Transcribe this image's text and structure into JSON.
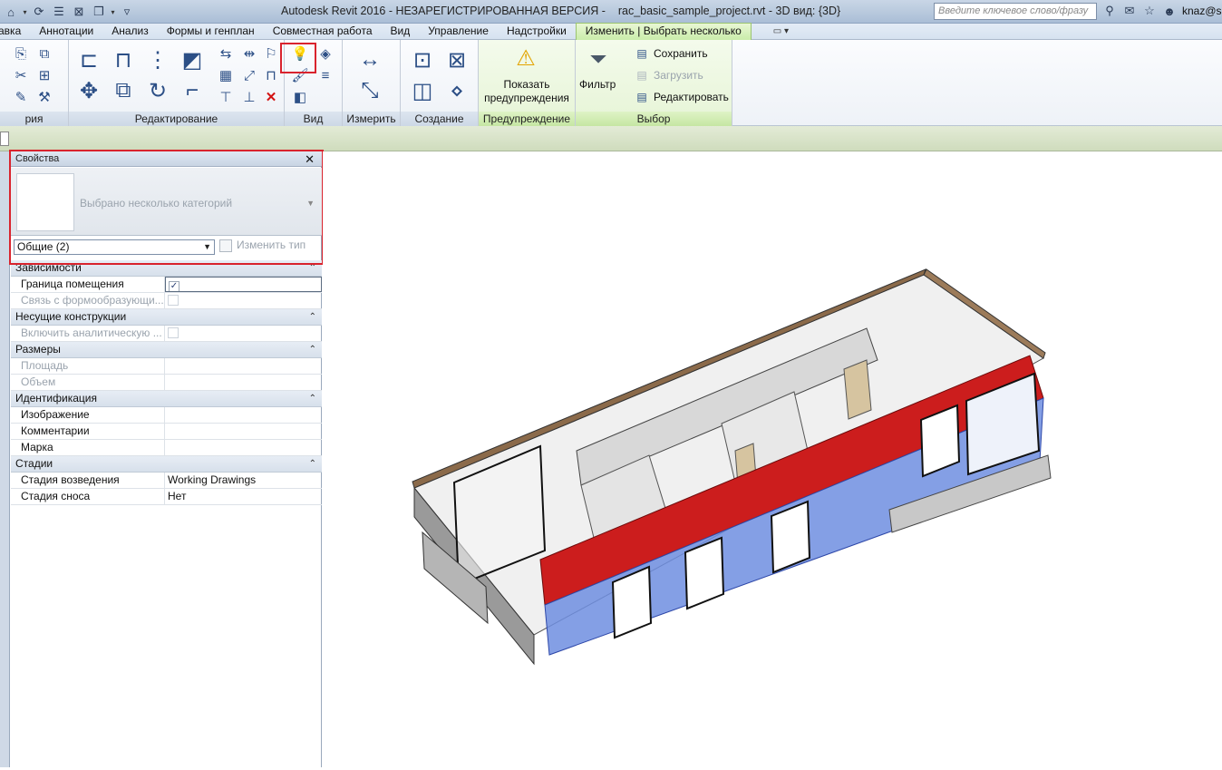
{
  "titlebar": {
    "title_main": "Autodesk Revit 2016 - НЕЗАРЕГИСТРИРОВАННАЯ ВЕРСИЯ -",
    "title_file": "rac_basic_sample_project.rvt - 3D вид: {3D}",
    "search_placeholder": "Введите ключевое слово/фразу",
    "user": "knaz@s"
  },
  "tabs": [
    "авка",
    "Аннотации",
    "Анализ",
    "Формы и генплан",
    "Совместная работа",
    "Вид",
    "Управление",
    "Надстройки",
    "Изменить | Выбрать несколько"
  ],
  "tab_extra": "▭ ▾",
  "ribbon": {
    "panels": {
      "geometry": "рия",
      "modify": "Редактирование",
      "view": "Вид",
      "measure": "Измерить",
      "create": "Создание",
      "warning": "Предупреждение",
      "selection": "Выбор"
    },
    "show_warnings_line1": "Показать",
    "show_warnings_line2": "предупреждения",
    "filter": "Фильтр",
    "save": "Сохранить",
    "load": "Загрузить",
    "edit": "Редактировать"
  },
  "properties": {
    "title": "Свойства",
    "type_text": "Выбрано несколько категорий",
    "category": "Общие (2)",
    "edit_type": "Изменить тип",
    "groups": [
      {
        "name": "Зависимости",
        "rows": [
          {
            "name": "Граница помещения",
            "value": "",
            "checkbox": "checked",
            "dim": false
          },
          {
            "name": "Связь с формообразующи...",
            "value": "",
            "checkbox": "off",
            "dim": true
          }
        ]
      },
      {
        "name": "Несущие конструкции",
        "rows": [
          {
            "name": "Включить аналитическую ...",
            "value": "",
            "checkbox": "off",
            "dim": true
          }
        ]
      },
      {
        "name": "Размеры",
        "rows": [
          {
            "name": "Площадь",
            "value": "",
            "dim": true
          },
          {
            "name": "Объем",
            "value": "",
            "dim": true
          }
        ]
      },
      {
        "name": "Идентификация",
        "rows": [
          {
            "name": "Изображение",
            "value": "",
            "dim": false
          },
          {
            "name": "Комментарии",
            "value": "",
            "dim": false
          },
          {
            "name": "Марка",
            "value": "",
            "dim": false
          }
        ]
      },
      {
        "name": "Стадии",
        "rows": [
          {
            "name": "Стадия возведения",
            "value": "Working Drawings",
            "dim": false
          },
          {
            "name": "Стадия сноса",
            "value": "Нет",
            "dim": false
          }
        ]
      }
    ]
  },
  "colors": {
    "highlight": "#d9232d",
    "selection_blue": "#6f8ee0",
    "roof_red": "#cc1d1d"
  }
}
